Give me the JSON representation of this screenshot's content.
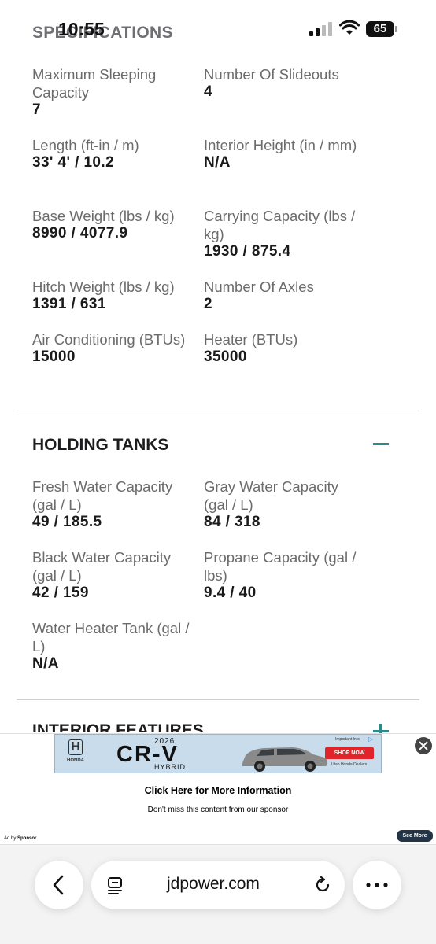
{
  "status_bar": {
    "time": "10:55",
    "battery": "65",
    "section_peek": "SPECIFICATIONS"
  },
  "specifications": [
    {
      "label": "Maximum Sleeping Capacity",
      "value": "7"
    },
    {
      "label": "Number Of Slideouts",
      "value": "4"
    },
    {
      "label": "Length (ft-in / m)",
      "value": "33' 4' / 10.2"
    },
    {
      "label": "Interior Height (in / mm)",
      "value": "N/A"
    },
    {
      "label": "Base Weight (lbs / kg)",
      "value": "8990 / 4077.9"
    },
    {
      "label": "Carrying Capacity (lbs / kg)",
      "value": "1930 / 875.4"
    },
    {
      "label": "Hitch Weight (lbs / kg)",
      "value": "1391 / 631"
    },
    {
      "label": "Number Of Axles",
      "value": "2"
    },
    {
      "label": "Air Conditioning (BTUs)",
      "value": "15000"
    },
    {
      "label": "Heater (BTUs)",
      "value": "35000"
    }
  ],
  "holding_tanks": {
    "title": "HOLDING TANKS",
    "items": [
      {
        "label": "Fresh Water Capacity (gal / L)",
        "value": "49 / 185.5"
      },
      {
        "label": "Gray Water Capacity (gal / L)",
        "value": "84 / 318"
      },
      {
        "label": "Black Water Capacity (gal / L)",
        "value": "42 / 159"
      },
      {
        "label": "Propane Capacity (gal / lbs)",
        "value": "9.4 / 40"
      },
      {
        "label": "Water Heater Tank (gal / L)",
        "value": "N/A"
      }
    ]
  },
  "interior_features": {
    "title": "INTERIOR FEATURES"
  },
  "ad": {
    "brand": "HONDA",
    "year": "2026",
    "model": "CR-V",
    "trim": "HYBRID",
    "important_info": "Important Info",
    "shop_now": "SHOP NOW",
    "dealers": "Utah Honda Dealers",
    "headline": "Click Here for More Information",
    "subtext": "Don't miss this content from our sponsor",
    "ad_by_prefix": "Ad by",
    "ad_by_name": "Sponsor",
    "see_more": "See More"
  },
  "browser": {
    "url": "jdpower.com"
  },
  "colors": {
    "accent": "#2a8a8a",
    "shop_button": "#e0242a",
    "see_more_button": "#243447"
  },
  "icons": [
    "back-chevron-icon",
    "reader-icon",
    "reload-icon",
    "more-icon",
    "close-icon",
    "signal-icon",
    "wifi-icon",
    "battery-icon"
  ]
}
